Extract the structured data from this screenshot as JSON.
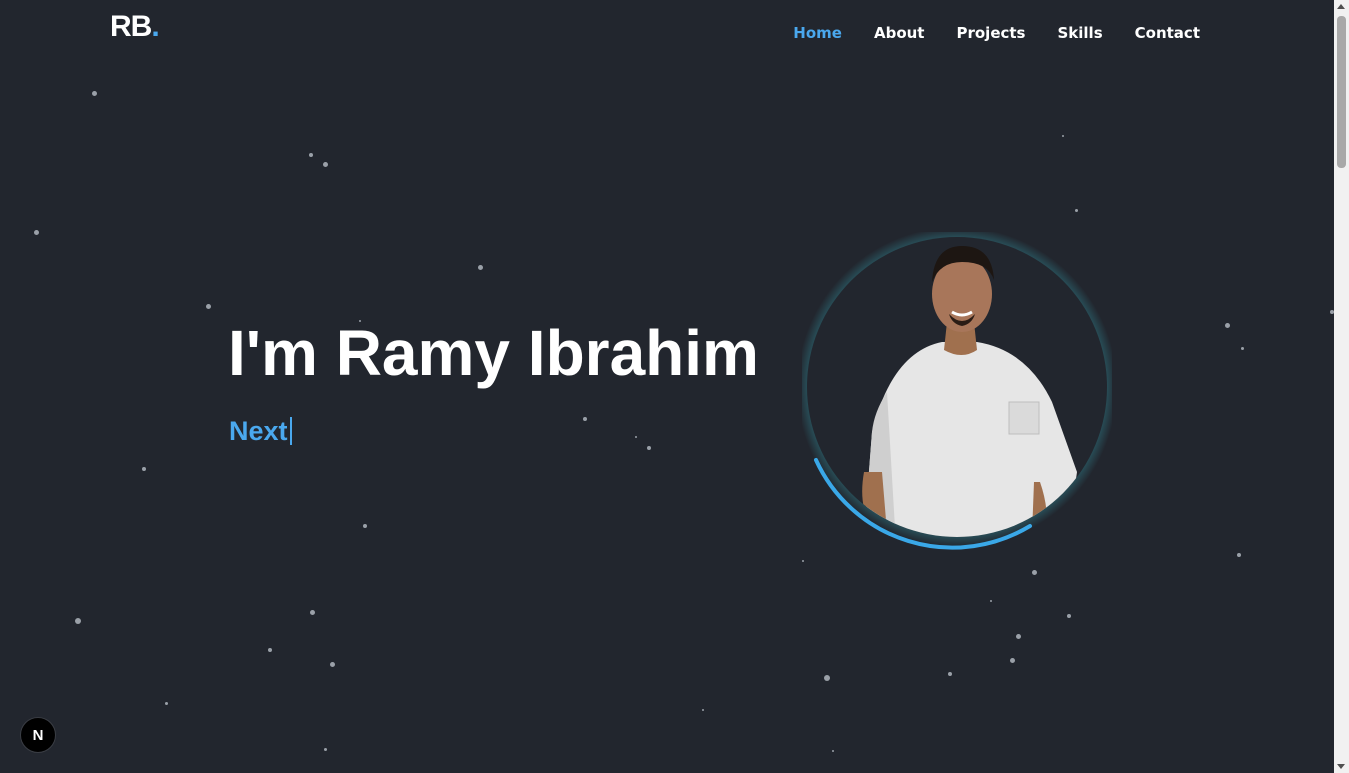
{
  "brand": {
    "logo_text": "RB",
    "logo_dot": ".",
    "accent_color": "#4aa8ee",
    "background_color": "#22262e"
  },
  "nav": {
    "items": [
      {
        "label": "Home",
        "active": true
      },
      {
        "label": "About",
        "active": false
      },
      {
        "label": "Projects",
        "active": false
      },
      {
        "label": "Skills",
        "active": false
      },
      {
        "label": "Contact",
        "active": false
      }
    ]
  },
  "hero": {
    "title": "I'm Ramy Ibrahim",
    "typed_text": "Next"
  },
  "avatar": {
    "description_icon": "profile-photo"
  },
  "badge": {
    "label": "N",
    "icon": "nextjs-logo-icon"
  }
}
